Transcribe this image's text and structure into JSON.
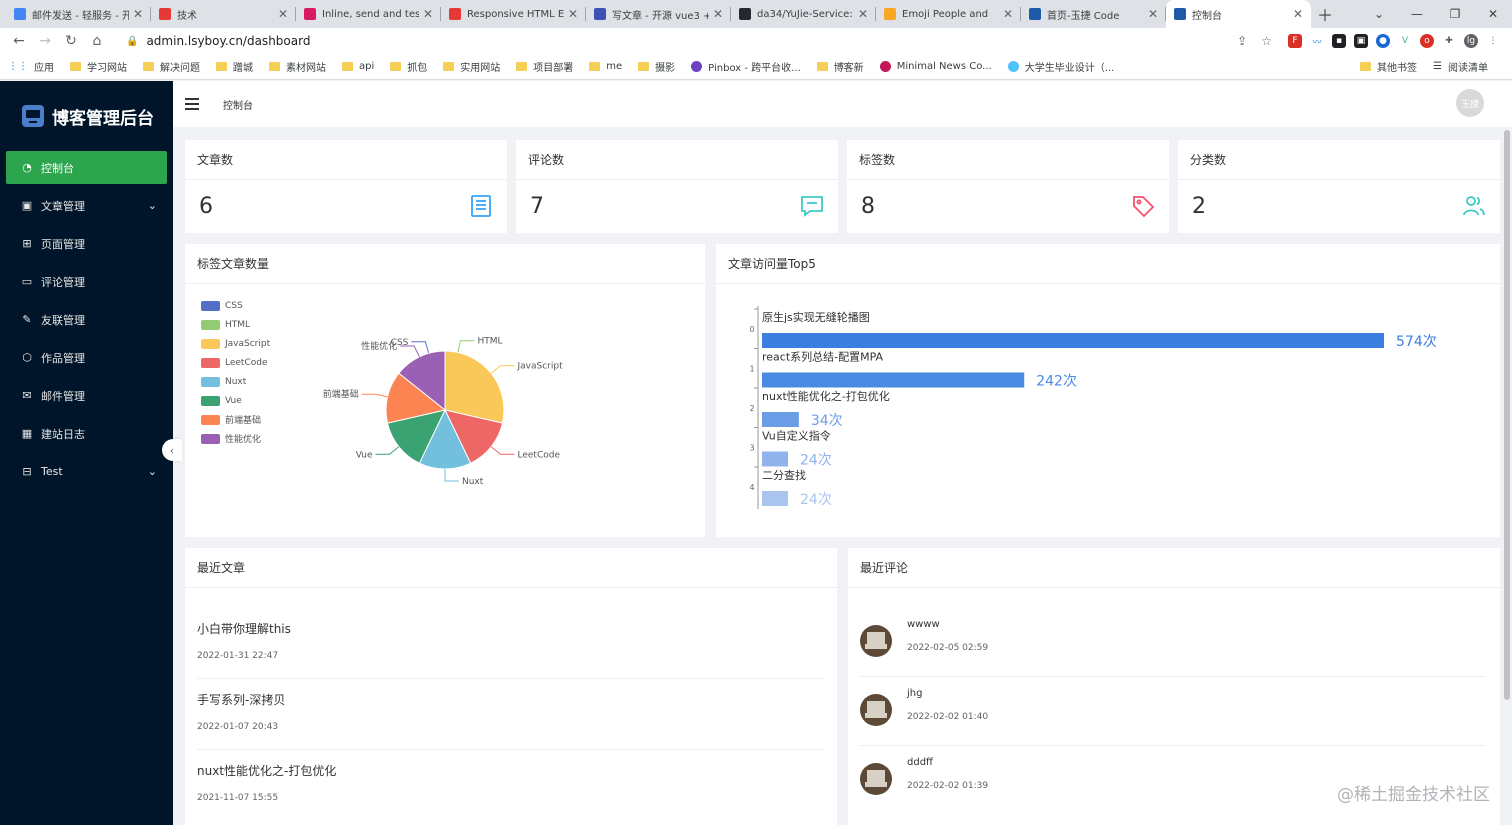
{
  "browser": {
    "tabs": [
      {
        "label": "邮件发送 - 轻服务 - 开",
        "icon_color": "#4285f4",
        "active": false
      },
      {
        "label": "技术",
        "icon_color": "#e53935",
        "active": false
      },
      {
        "label": "Inline, send and test",
        "icon_color": "#d81b60",
        "active": false
      },
      {
        "label": "Responsive HTML Em",
        "icon_color": "#e53935",
        "active": false
      },
      {
        "label": "写文章 - 开源 vue3 +",
        "icon_color": "#3f51b5",
        "active": false
      },
      {
        "label": "da34/YuJie-Service:",
        "icon_color": "#24292e",
        "active": false
      },
      {
        "label": "Emoji People and",
        "icon_color": "#f9a825",
        "active": false
      },
      {
        "label": "首页-玉捷 Code",
        "icon_color": "#1e5aa8",
        "active": false
      },
      {
        "label": "控制台",
        "icon_color": "#1e5aa8",
        "active": true
      }
    ],
    "url": "admin.lsyboy.cn/dashboard",
    "bookmarks_left": [
      "应用",
      "学习网站",
      "解决问题",
      "蹭城",
      "素材网站",
      "api",
      "抓包",
      "实用网站",
      "项目部署",
      "me",
      "摄影",
      "Pinbox - 跨平台收...",
      "博客新",
      "Minimal News Co...",
      "大学生毕业设计（..."
    ],
    "bookmarks_right": [
      "其他书签",
      "阅读清单"
    ]
  },
  "sidebar": {
    "brand": "博客管理后台",
    "items": [
      {
        "label": "控制台",
        "icon": "dashboard-icon",
        "active": true,
        "has_chevron": false
      },
      {
        "label": "文章管理",
        "icon": "article-icon",
        "active": false,
        "has_chevron": true
      },
      {
        "label": "页面管理",
        "icon": "page-icon",
        "active": false,
        "has_chevron": false
      },
      {
        "label": "评论管理",
        "icon": "comment-icon",
        "active": false,
        "has_chevron": false
      },
      {
        "label": "友联管理",
        "icon": "link-icon",
        "active": false,
        "has_chevron": false
      },
      {
        "label": "作品管理",
        "icon": "works-icon",
        "active": false,
        "has_chevron": false
      },
      {
        "label": "邮件管理",
        "icon": "mail-icon",
        "active": false,
        "has_chevron": false
      },
      {
        "label": "建站日志",
        "icon": "log-icon",
        "active": false,
        "has_chevron": false
      },
      {
        "label": "Test",
        "icon": "test-icon",
        "active": false,
        "has_chevron": true
      }
    ]
  },
  "header": {
    "breadcrumb": "控制台",
    "avatar_text": "玉捷"
  },
  "stats": [
    {
      "label": "文章数",
      "value": "6",
      "icon": "document-icon",
      "color": "#36a3f7"
    },
    {
      "label": "评论数",
      "value": "7",
      "icon": "message-icon",
      "color": "#40c9c6"
    },
    {
      "label": "标签数",
      "value": "8",
      "icon": "tag-icon",
      "color": "#f4516c"
    },
    {
      "label": "分类数",
      "value": "2",
      "icon": "users-icon",
      "color": "#40c9c6"
    }
  ],
  "pie_card": {
    "title": "标签文章数量"
  },
  "bar_card": {
    "title": "文章访问量Top5"
  },
  "chart_data": [
    {
      "type": "pie",
      "labels": [
        "CSS",
        "HTML",
        "JavaScript",
        "LeetCode",
        "Nuxt",
        "Vue",
        "前端基础",
        "性能优化"
      ],
      "values": [
        0,
        0,
        2,
        1,
        1,
        1,
        1,
        1
      ],
      "colors": [
        "#5470c6",
        "#91cc75",
        "#fac858",
        "#ee6666",
        "#73c0de",
        "#3ba272",
        "#fc8452",
        "#9a60b4"
      ],
      "legend": "left"
    },
    {
      "type": "bar",
      "orientation": "horizontal",
      "categories": [
        "原生js实现无缝轮播图",
        "react系列总结-配置MPA",
        "nuxt性能优化之-打包优化",
        "Vu自定义指令",
        "二分查找"
      ],
      "values": [
        574,
        242,
        34,
        24,
        24
      ],
      "value_suffix": "次",
      "index_labels": [
        "0",
        "1",
        "2",
        "3",
        "4"
      ],
      "colors": [
        "#3a7fe0",
        "#4a8ae3",
        "#6a9de6",
        "#8fb3ea",
        "#a9c5ee"
      ]
    }
  ],
  "recent_articles": {
    "title": "最近文章",
    "items": [
      {
        "title": "小白带你理解this",
        "date": "2022-01-31 22:47"
      },
      {
        "title": "手写系列-深拷贝",
        "date": "2022-01-07 20:43"
      },
      {
        "title": "nuxt性能优化之-打包优化",
        "date": "2021-11-07 15:55"
      }
    ]
  },
  "recent_comments": {
    "title": "最近评论",
    "items": [
      {
        "name": "wwww",
        "date": "2022-02-05 02:59"
      },
      {
        "name": "jhg",
        "date": "2022-02-02 01:40"
      },
      {
        "name": "dddff",
        "date": "2022-02-02 01:39"
      }
    ]
  },
  "watermark": "@稀土掘金技术社区"
}
